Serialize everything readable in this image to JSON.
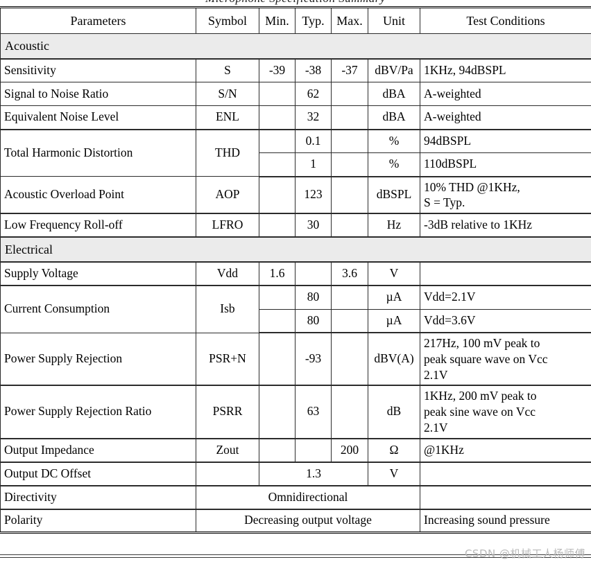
{
  "caption_cut": "Microphone Specification Summary",
  "header": {
    "columns": [
      "Parameters",
      "Symbol",
      "Min.",
      "Typ.",
      "Max.",
      "Unit",
      "Test Conditions"
    ]
  },
  "sections": [
    {
      "label": "Acoustic"
    },
    {
      "label": "Electrical"
    }
  ],
  "rows": {
    "sensitivity": {
      "parameter": "Sensitivity",
      "symbol": "S",
      "min": "-39",
      "typ": "-38",
      "max": "-37",
      "unit": "dBV/Pa",
      "test": "1KHz, 94dBSPL"
    },
    "snr": {
      "parameter": "Signal to Noise Ratio",
      "symbol": "S/N",
      "min": "",
      "typ": "62",
      "max": "",
      "unit": "dBA",
      "test": "A-weighted"
    },
    "enl": {
      "parameter": "Equivalent Noise Level",
      "symbol": "ENL",
      "min": "",
      "typ": "32",
      "max": "",
      "unit": "dBA",
      "test": "A-weighted"
    },
    "thd": {
      "parameter": "Total Harmonic Distortion",
      "symbol": "THD",
      "line1": {
        "min": "",
        "typ": "0.1",
        "max": "",
        "unit": "%",
        "test": "94dBSPL"
      },
      "line2": {
        "min": "",
        "typ": "1",
        "max": "",
        "unit": "%",
        "test": "110dBSPL"
      }
    },
    "aop": {
      "parameter": "Acoustic Overload Point",
      "symbol": "AOP",
      "min": "",
      "typ": "123",
      "max": "",
      "unit": "dBSPL",
      "test_line1": "10% THD @1KHz,",
      "test_line2": "S = Typ."
    },
    "lfro": {
      "parameter": "Low Frequency Roll-off",
      "symbol": "LFRO",
      "min": "",
      "typ": "30",
      "max": "",
      "unit": "Hz",
      "test": "-3dB relative to 1KHz"
    },
    "supply_voltage": {
      "parameter": "Supply Voltage",
      "symbol": "Vdd",
      "min": "1.6",
      "typ": "",
      "max": "3.6",
      "unit": "V",
      "test": ""
    },
    "current_consumption": {
      "parameter": "Current Consumption",
      "symbol": "Isb",
      "line1": {
        "min": "",
        "typ": "80",
        "max": "",
        "unit": "µA",
        "test": "Vdd=2.1V"
      },
      "line2": {
        "min": "",
        "typ": "80",
        "max": "",
        "unit": "µA",
        "test": "Vdd=3.6V"
      }
    },
    "psr": {
      "parameter": "Power Supply Rejection",
      "symbol": "PSR+N",
      "min": "",
      "typ": "-93",
      "max": "",
      "unit": "dBV(A)",
      "test_line1": "217Hz, 100 mV peak to",
      "test_line2": "peak square wave on Vcc",
      "test_line3": "2.1V"
    },
    "psrr": {
      "parameter": "Power Supply Rejection Ratio",
      "symbol": "PSRR",
      "min": "",
      "typ": "63",
      "max": "",
      "unit": "dB",
      "test_line1": "1KHz, 200 mV peak to",
      "test_line2": "peak sine wave on Vcc",
      "test_line3": "2.1V"
    },
    "zout": {
      "parameter": "Output Impedance",
      "symbol": "Zout",
      "min": "",
      "typ": "",
      "max": "200",
      "unit": "Ω",
      "test": "@1KHz"
    },
    "dc_offset": {
      "parameter": "Output DC Offset",
      "symbol": "",
      "value": "1.3",
      "unit": "V",
      "test": ""
    },
    "directivity": {
      "parameter": "Directivity",
      "value": "Omnidirectional",
      "test": ""
    },
    "polarity": {
      "parameter": "Polarity",
      "value": "Decreasing output voltage",
      "test": "Increasing sound pressure"
    }
  },
  "watermark": {
    "text": "CSDN @机械工人杨师傅"
  },
  "colors": {
    "section_band": "#ebebeb",
    "border": "#2b2b2b",
    "text": "#000000",
    "watermark": "#b9b9b9"
  }
}
